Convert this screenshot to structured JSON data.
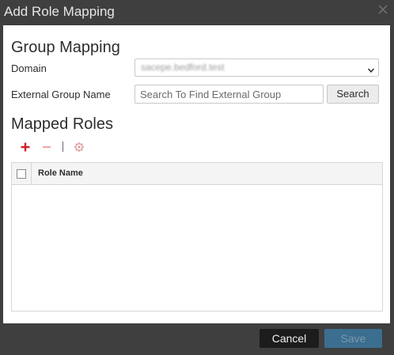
{
  "dialog": {
    "title": "Add Role Mapping",
    "close_icon": "close-icon"
  },
  "group_mapping": {
    "heading": "Group Mapping",
    "domain_label": "Domain",
    "domain_value": "sacepe.bedford.test",
    "external_group_label": "External Group Name",
    "external_group_placeholder": "Search To Find External Group",
    "external_group_value": "",
    "search_button": "Search"
  },
  "mapped_roles": {
    "heading": "Mapped Roles",
    "toolbar": {
      "add_icon": "plus-icon",
      "remove_icon": "minus-icon",
      "settings_icon": "gear-icon"
    },
    "table": {
      "columns": [
        "Role Name"
      ],
      "rows": []
    }
  },
  "footer": {
    "cancel_label": "Cancel",
    "save_label": "Save"
  },
  "colors": {
    "dialog_chrome": "#3f3f3f",
    "add_icon": "#d0202a",
    "remove_icon": "#f2a7a7",
    "cancel_button": "#1c1c1c",
    "save_button": "#3b6e8f"
  }
}
